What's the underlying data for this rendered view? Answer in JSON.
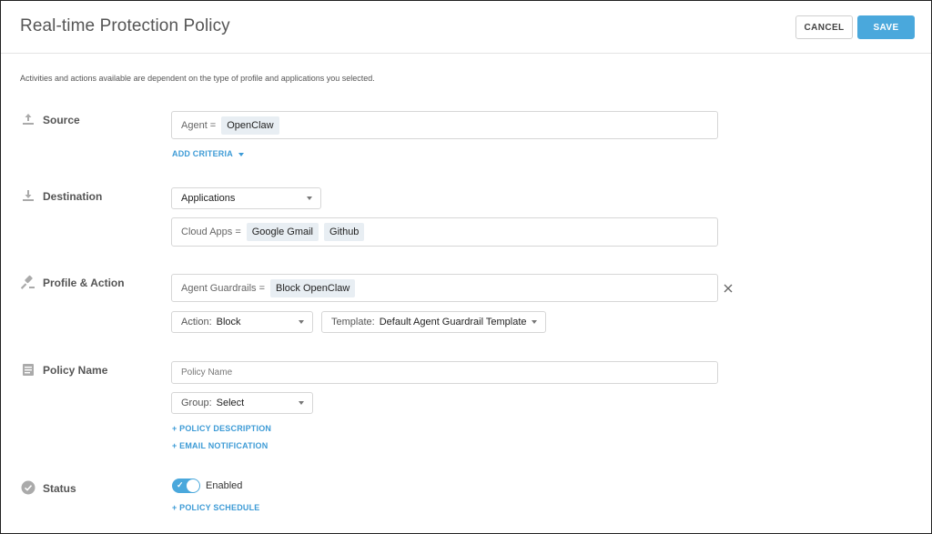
{
  "header": {
    "title": "Real-time Protection Policy",
    "cancel_label": "CANCEL",
    "save_label": "SAVE"
  },
  "intro_text": "Activities and actions available are dependent on the type of profile and applications you selected.",
  "source": {
    "label": "Source",
    "icon": "upload-icon",
    "field_label": "Agent =",
    "chips": [
      "OpenClaw"
    ],
    "add_criteria_label": "ADD CRITERIA"
  },
  "destination": {
    "label": "Destination",
    "icon": "download-icon",
    "dropdown_value": "Applications",
    "field_label": "Cloud Apps =",
    "chips": [
      "Google Gmail",
      "Github"
    ]
  },
  "profile_action": {
    "label": "Profile & Action",
    "icon": "gavel-icon",
    "field_label": "Agent Guardrails =",
    "chips": [
      "Block OpenClaw"
    ],
    "action_label": "Action:",
    "action_value": "Block",
    "template_label": "Template:",
    "template_value": "Default Agent Guardrail Template"
  },
  "policy_name": {
    "label": "Policy Name",
    "icon": "document-icon",
    "input_placeholder": "Policy Name",
    "group_label": "Group:",
    "group_value": "Select",
    "description_link": "+ POLICY DESCRIPTION",
    "email_link": "+ EMAIL NOTIFICATION"
  },
  "status": {
    "label": "Status",
    "icon": "check-circle-icon",
    "toggle_value": "Enabled",
    "toggle_on": true,
    "schedule_link": "+ POLICY SCHEDULE"
  },
  "colors": {
    "accent": "#4aa8dc",
    "chip_bg": "#e8eef3",
    "border": "#d6d6d6"
  }
}
